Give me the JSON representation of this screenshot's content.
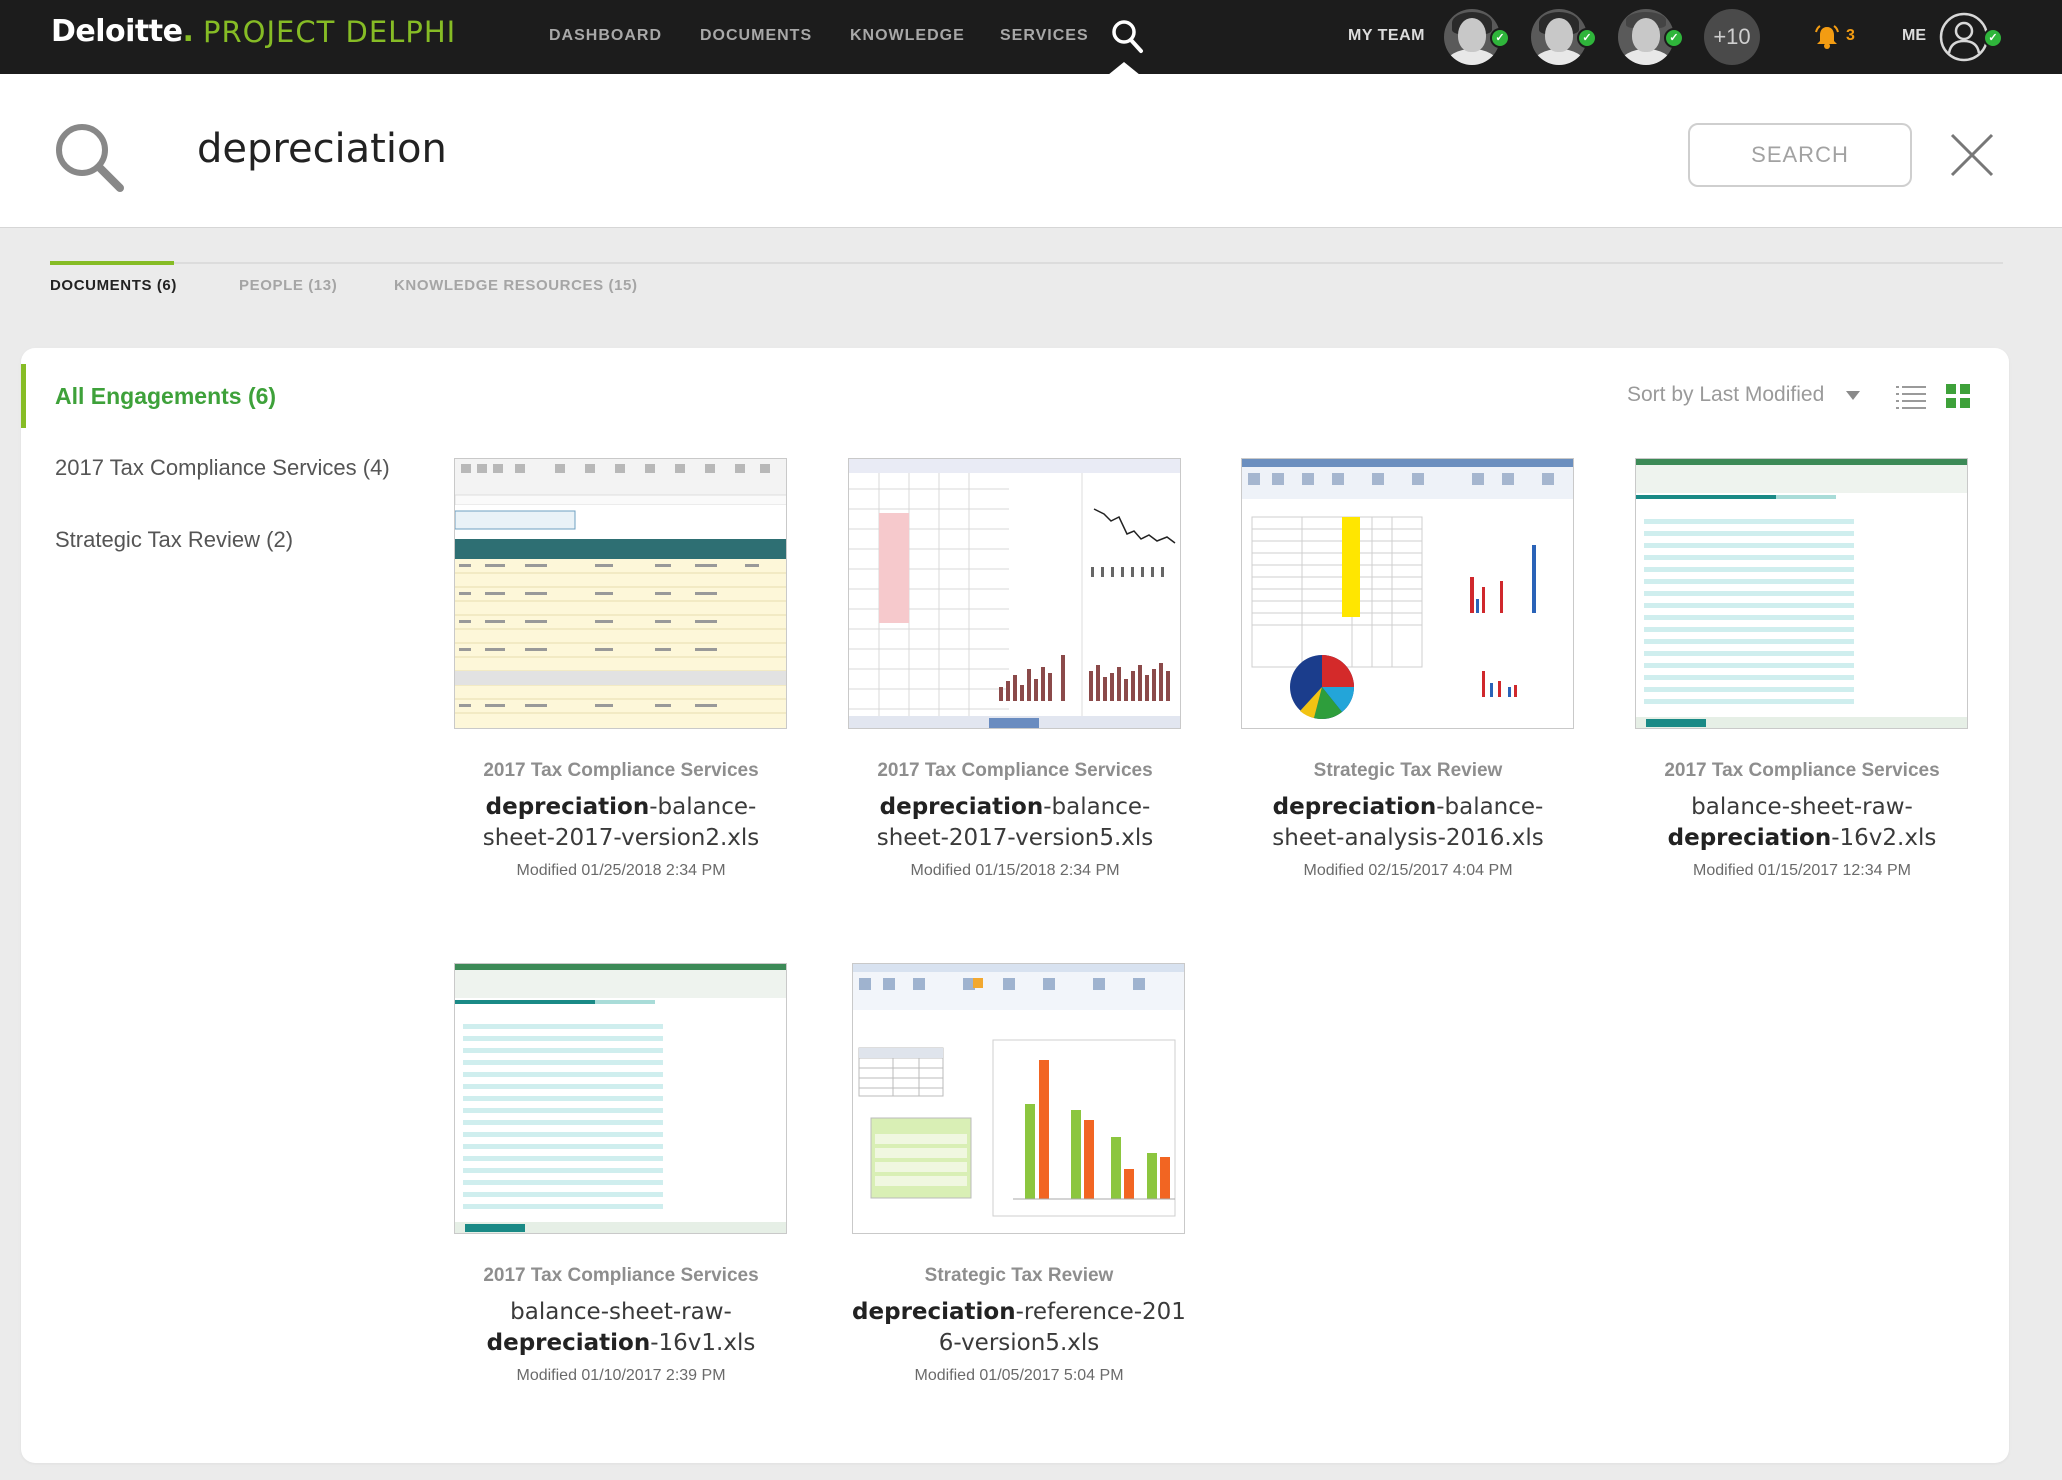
{
  "brand": {
    "name": "Deloitte",
    "dot": ".",
    "project": "PROJECT DELPHI"
  },
  "nav": {
    "items": [
      "DASHBOARD",
      "DOCUMENTS",
      "KNOWLEDGE",
      "SERVICES"
    ]
  },
  "team": {
    "label": "MY TEAM",
    "more": "+10"
  },
  "notifications": {
    "count": "3"
  },
  "me": {
    "label": "ME"
  },
  "search": {
    "query": "depreciation",
    "button": "SEARCH"
  },
  "tabs": [
    {
      "label": "DOCUMENTS (6)",
      "active": true
    },
    {
      "label": "PEOPLE (13)",
      "active": false
    },
    {
      "label": "KNOWLEDGE RESOURCES (15)",
      "active": false
    }
  ],
  "filters": {
    "all": "All Engagements (6)",
    "items": [
      "2017 Tax Compliance Services (4)",
      "Strategic Tax Review (2)"
    ]
  },
  "sort": {
    "label": "Sort by Last Modified"
  },
  "documents": [
    {
      "engagement": "2017 Tax Compliance Services",
      "name_pre": "",
      "name_bold": "depreciation",
      "name_post": "-balance-sheet-2017-version2.xls",
      "modified": "Modified 01/25/2018  2:34 PM"
    },
    {
      "engagement": "2017 Tax Compliance Services",
      "name_pre": "",
      "name_bold": "depreciation",
      "name_post": "-balance-sheet-2017-version5.xls",
      "modified": "Modified 01/15/2018  2:34 PM"
    },
    {
      "engagement": "Strategic Tax Review",
      "name_pre": "",
      "name_bold": "depreciation",
      "name_post": "-balance-sheet-analysis-2016.xls",
      "modified": "Modified 02/15/2017  4:04 PM"
    },
    {
      "engagement": "2017 Tax Compliance Services",
      "name_pre": "balance-sheet-raw-",
      "name_bold": "depreciation",
      "name_post": "-16v2.xls",
      "modified": "Modified 01/15/2017  12:34 PM"
    },
    {
      "engagement": "2017 Tax Compliance Services",
      "name_pre": "balance-sheet-raw-",
      "name_bold": "depreciation",
      "name_post": "-16v1.xls",
      "modified": "Modified 01/10/2017  2:39 PM"
    },
    {
      "engagement": "Strategic Tax Review",
      "name_pre": "",
      "name_bold": "depreciation",
      "name_post": "-reference-2016-version5.xls",
      "modified": "Modified 01/05/2017 5:04 PM"
    }
  ],
  "colors": {
    "brand_green": "#86bc25",
    "filter_green": "#3ea13a",
    "topbar": "#1c1c1c",
    "status_green": "#2fb53b",
    "bell": "#f39c12"
  },
  "icons": {
    "search": "search-icon",
    "close": "close-icon",
    "bell": "bell-icon",
    "user": "user-icon",
    "list": "list-view-icon",
    "grid": "grid-view-icon"
  }
}
